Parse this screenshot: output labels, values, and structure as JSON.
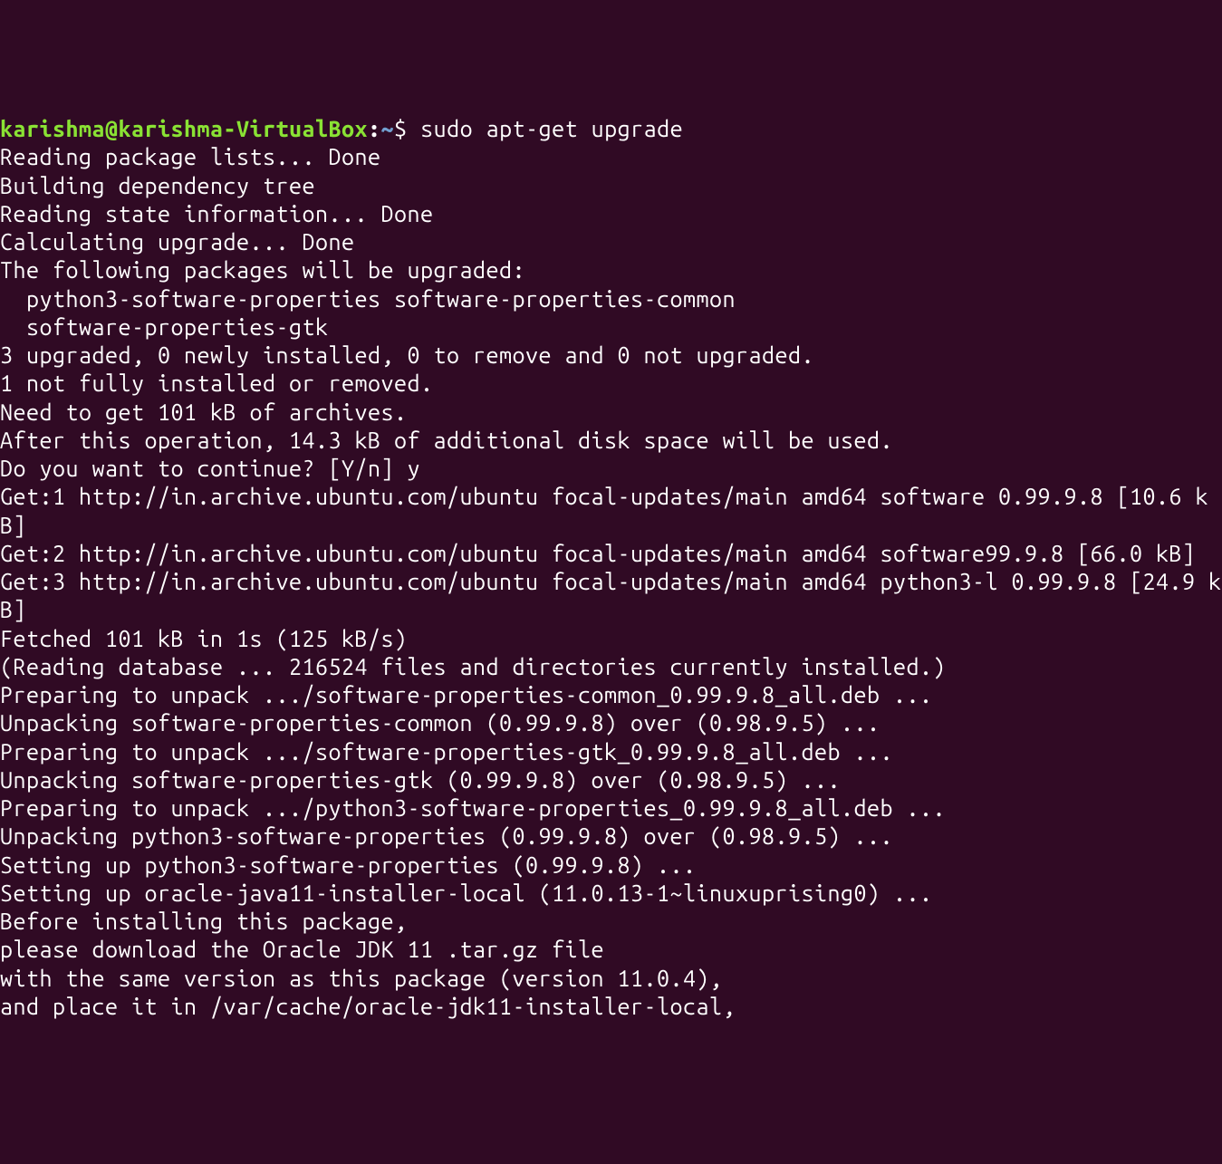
{
  "prompt": {
    "user_host": "karishma@karishma-VirtualBox",
    "colon": ":",
    "path": "~",
    "dollar": "$",
    "command": " sudo apt-get upgrade"
  },
  "lines": [
    "Reading package lists... Done",
    "Building dependency tree",
    "Reading state information... Done",
    "Calculating upgrade... Done",
    "The following packages will be upgraded:",
    "  python3-software-properties software-properties-common",
    "  software-properties-gtk",
    "3 upgraded, 0 newly installed, 0 to remove and 0 not upgraded.",
    "1 not fully installed or removed.",
    "Need to get 101 kB of archives.",
    "After this operation, 14.3 kB of additional disk space will be used.",
    "Do you want to continue? [Y/n] y",
    "Get:1 http://in.archive.ubuntu.com/ubuntu focal-updates/main amd64 software 0.99.9.8 [10.6 kB]",
    "Get:2 http://in.archive.ubuntu.com/ubuntu focal-updates/main amd64 software99.9.8 [66.0 kB]",
    "Get:3 http://in.archive.ubuntu.com/ubuntu focal-updates/main amd64 python3-l 0.99.9.8 [24.9 kB]",
    "Fetched 101 kB in 1s (125 kB/s)",
    "(Reading database ... 216524 files and directories currently installed.)",
    "Preparing to unpack .../software-properties-common_0.99.9.8_all.deb ...",
    "Unpacking software-properties-common (0.99.9.8) over (0.98.9.5) ...",
    "Preparing to unpack .../software-properties-gtk_0.99.9.8_all.deb ...",
    "Unpacking software-properties-gtk (0.99.9.8) over (0.98.9.5) ...",
    "Preparing to unpack .../python3-software-properties_0.99.9.8_all.deb ...",
    "Unpacking python3-software-properties (0.99.9.8) over (0.98.9.5) ...",
    "Setting up python3-software-properties (0.99.9.8) ...",
    "Setting up oracle-java11-installer-local (11.0.13-1~linuxuprising0) ...",
    "Before installing this package,",
    "please download the Oracle JDK 11 .tar.gz file",
    "with the same version as this package (version 11.0.4),",
    "and place it in /var/cache/oracle-jdk11-installer-local,"
  ]
}
